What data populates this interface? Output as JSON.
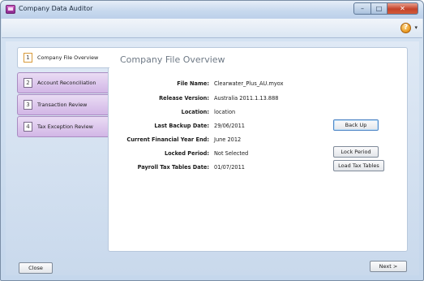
{
  "window": {
    "title": "Company Data Auditor"
  },
  "nav": {
    "items": [
      {
        "num": "1",
        "label": "Company File Overview",
        "active": true
      },
      {
        "num": "2",
        "label": "Account Reconciliation",
        "active": false
      },
      {
        "num": "3",
        "label": "Transaction Review",
        "active": false
      },
      {
        "num": "4",
        "label": "Tax Exception Review",
        "active": false
      }
    ]
  },
  "panel": {
    "title": "Company File Overview",
    "fields": [
      {
        "label": "File Name:",
        "value": "Clearwater_Plus_AU.myox"
      },
      {
        "label": "Release Version:",
        "value": "Australia 2011.1.13.888"
      },
      {
        "label": "Location:",
        "value": "location"
      },
      {
        "label": "Last Backup Date:",
        "value": "29/06/2011"
      },
      {
        "label": "Current Financial Year End:",
        "value": "June 2012"
      },
      {
        "label": "Locked Period:",
        "value": "Not Selected"
      },
      {
        "label": "Payroll Tax Tables Date:",
        "value": "01/07/2011"
      }
    ],
    "buttons": {
      "back_up": "Back Up",
      "lock_period": "Lock Period",
      "load_tax_tables": "Load Tax Tables"
    }
  },
  "footer": {
    "close": "Close",
    "next": "Next >"
  },
  "icons": {
    "app": "app-icon",
    "help": "help-icon"
  }
}
